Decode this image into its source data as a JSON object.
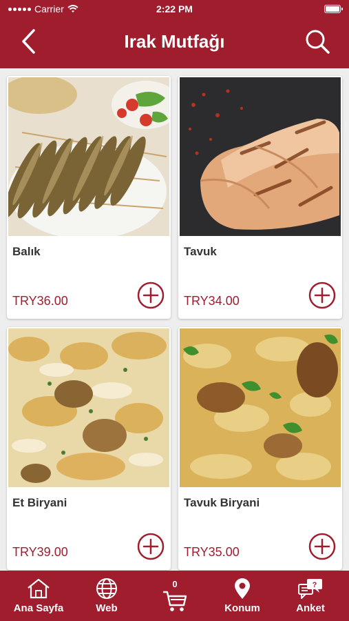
{
  "status": {
    "carrier": "Carrier",
    "time": "2:22 PM"
  },
  "header": {
    "title": "Irak Mutfağı",
    "back_icon": "chevron-left-icon",
    "search_icon": "search-icon"
  },
  "colors": {
    "brand": "#a01d2e",
    "background": "#eeeeee",
    "card": "#ffffff",
    "text": "#333333"
  },
  "products": [
    {
      "name": "Balık",
      "price": "TRY36.00",
      "image": "grilled-fish-skewers-photo"
    },
    {
      "name": "Tavuk",
      "price": "TRY34.00",
      "image": "grilled-chicken-breast-photo"
    },
    {
      "name": "Et Biryani",
      "price": "TRY39.00",
      "image": "meat-biryani-photo"
    },
    {
      "name": "Tavuk Biryani",
      "price": "TRY35.00",
      "image": "chicken-biryani-photo"
    }
  ],
  "tabbar": {
    "items": [
      {
        "label": "Ana Sayfa",
        "icon": "home-icon"
      },
      {
        "label": "Web",
        "icon": "globe-icon"
      },
      {
        "label": "",
        "icon": "cart-icon",
        "badge": "0"
      },
      {
        "label": "Konum",
        "icon": "location-pin-icon"
      },
      {
        "label": "Anket",
        "icon": "survey-chat-icon"
      }
    ]
  }
}
